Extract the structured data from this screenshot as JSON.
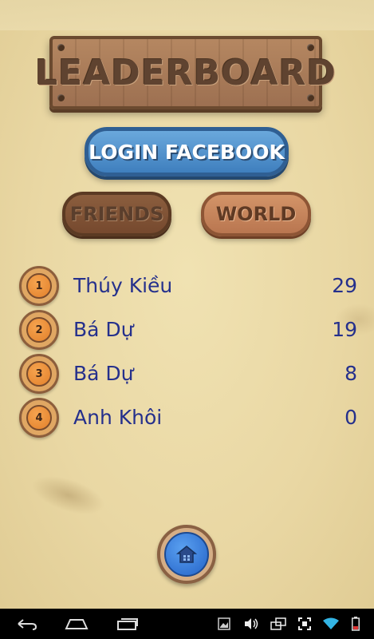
{
  "header": {
    "title": "LEADERBOARD"
  },
  "buttons": {
    "login": "LOGIN FACEBOOK",
    "friends": "FRIENDS",
    "world": "WORLD"
  },
  "leaderboard": [
    {
      "rank": "1",
      "name": "Thúy Kiều",
      "score": "29"
    },
    {
      "rank": "2",
      "name": "Bá Dự",
      "score": "19"
    },
    {
      "rank": "3",
      "name": "Bá Dự",
      "score": "8"
    },
    {
      "rank": "4",
      "name": "Anh Khôi",
      "score": "0"
    }
  ],
  "home_button": {
    "icon": "home-icon"
  },
  "nav_bar": {
    "left_icons": [
      "back-icon",
      "home-icon",
      "recent-apps-icon"
    ],
    "right_icons": [
      "screenshot-icon",
      "volume-icon",
      "rotate-icon",
      "fullscreen-icon",
      "wifi-icon",
      "battery-icon"
    ]
  },
  "colors": {
    "background": "#ecdcaa",
    "name_text": "#25308c",
    "login_button": "#4a8ccc",
    "medal": "#f39a45"
  }
}
